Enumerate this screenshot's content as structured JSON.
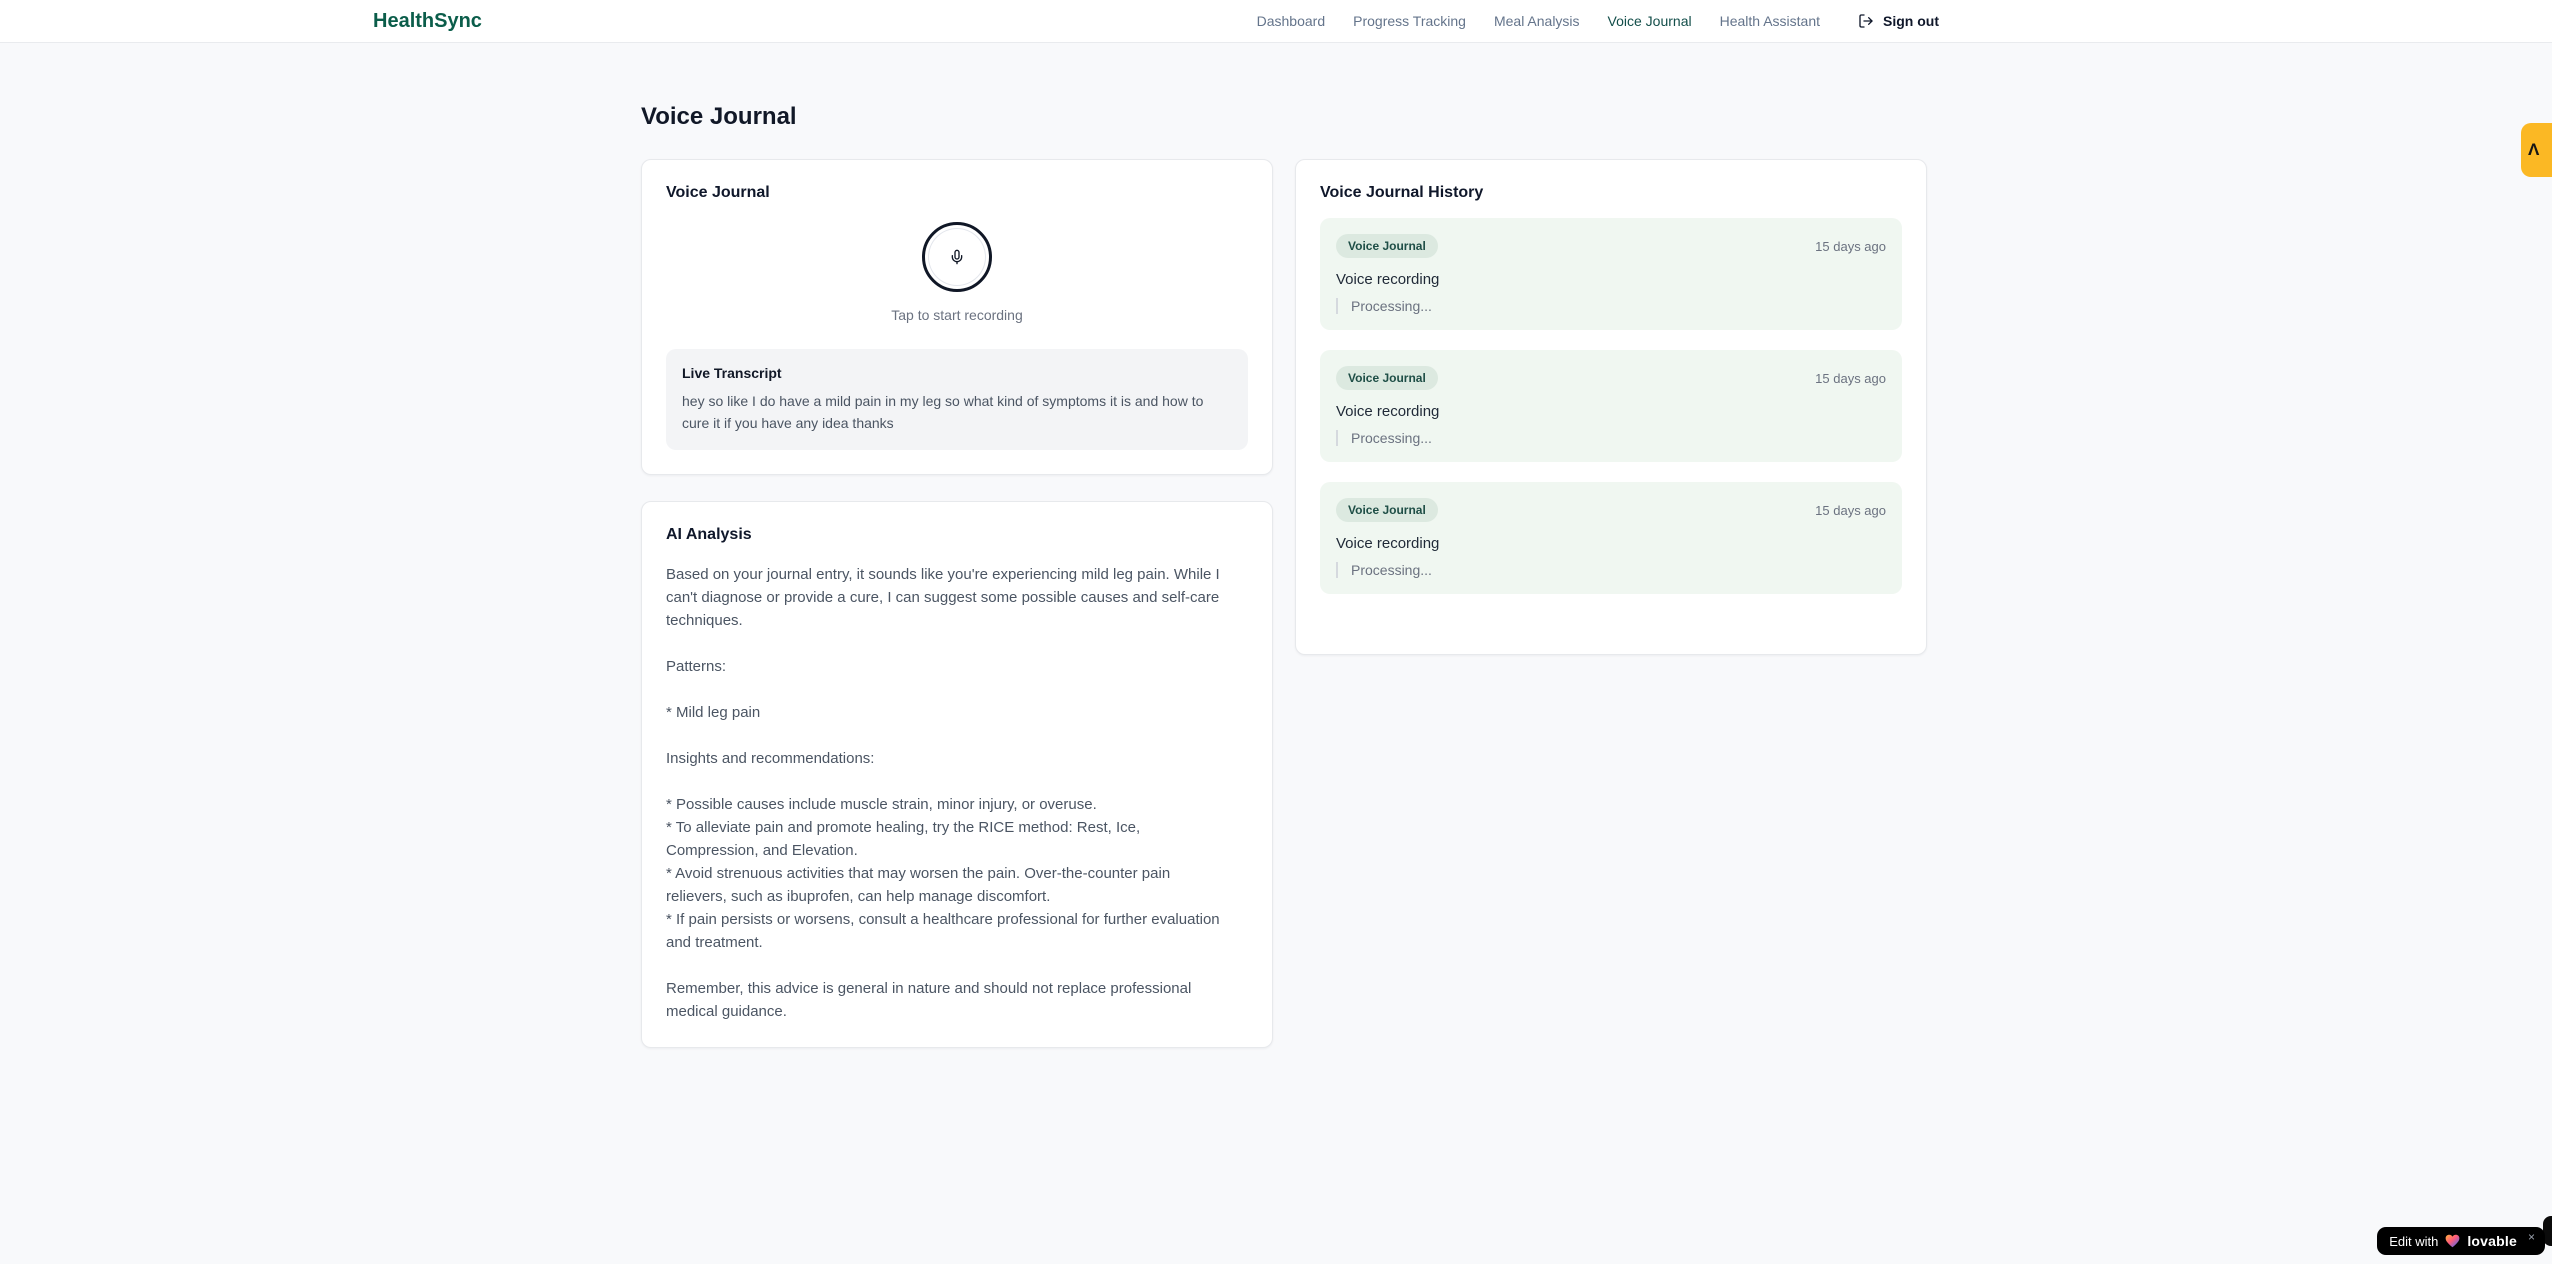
{
  "brand": {
    "name": "HealthSync"
  },
  "nav": {
    "items": [
      {
        "label": "Dashboard",
        "active": false
      },
      {
        "label": "Progress Tracking",
        "active": false
      },
      {
        "label": "Meal Analysis",
        "active": false
      },
      {
        "label": "Voice Journal",
        "active": true
      },
      {
        "label": "Health Assistant",
        "active": false
      }
    ],
    "sign_out": "Sign out"
  },
  "page": {
    "title": "Voice Journal"
  },
  "recorder_card": {
    "title": "Voice Journal",
    "tap_hint": "Tap to start recording",
    "transcript_title": "Live Transcript",
    "transcript_text": "hey so like I do have a mild pain in my leg so what kind of symptoms it is and how to cure it if you have any idea thanks"
  },
  "analysis_card": {
    "title": "AI Analysis",
    "body": "Based on your journal entry, it sounds like you're experiencing mild leg pain. While I\ncan't diagnose or provide a cure, I can suggest some possible causes and self-care\ntechniques.\n\nPatterns:\n\n* Mild leg pain\n\nInsights and recommendations:\n\n* Possible causes include muscle strain, minor injury, or overuse.\n* To alleviate pain and promote healing, try the RICE method: Rest, Ice,\nCompression, and Elevation.\n* Avoid strenuous activities that may worsen the pain. Over-the-counter pain\nrelievers, such as ibuprofen, can help manage discomfort.\n* If pain persists or worsens, consult a healthcare professional for further evaluation\nand treatment.\n\nRemember, this advice is general in nature and should not replace professional\nmedical guidance."
  },
  "history_card": {
    "title": "Voice Journal History",
    "entries": [
      {
        "badge": "Voice Journal",
        "time": "15 days ago",
        "name": "Voice recording",
        "status": "Processing..."
      },
      {
        "badge": "Voice Journal",
        "time": "15 days ago",
        "name": "Voice recording",
        "status": "Processing..."
      },
      {
        "badge": "Voice Journal",
        "time": "15 days ago",
        "name": "Voice recording",
        "status": "Processing..."
      }
    ]
  },
  "widgets": {
    "amber_tab_glyph": "Λ",
    "edit_label": "Edit with",
    "lovable_brand": "lovable",
    "close": "×"
  },
  "colors": {
    "brand_green": "#0b5d4a",
    "active_nav": "#134e4a",
    "history_entry_bg": "#f0f7f1",
    "badge_bg": "#dce9e0",
    "badge_text": "#1e4e46",
    "amber_tab": "#fbb824",
    "page_bg": "#f8f9fb"
  }
}
